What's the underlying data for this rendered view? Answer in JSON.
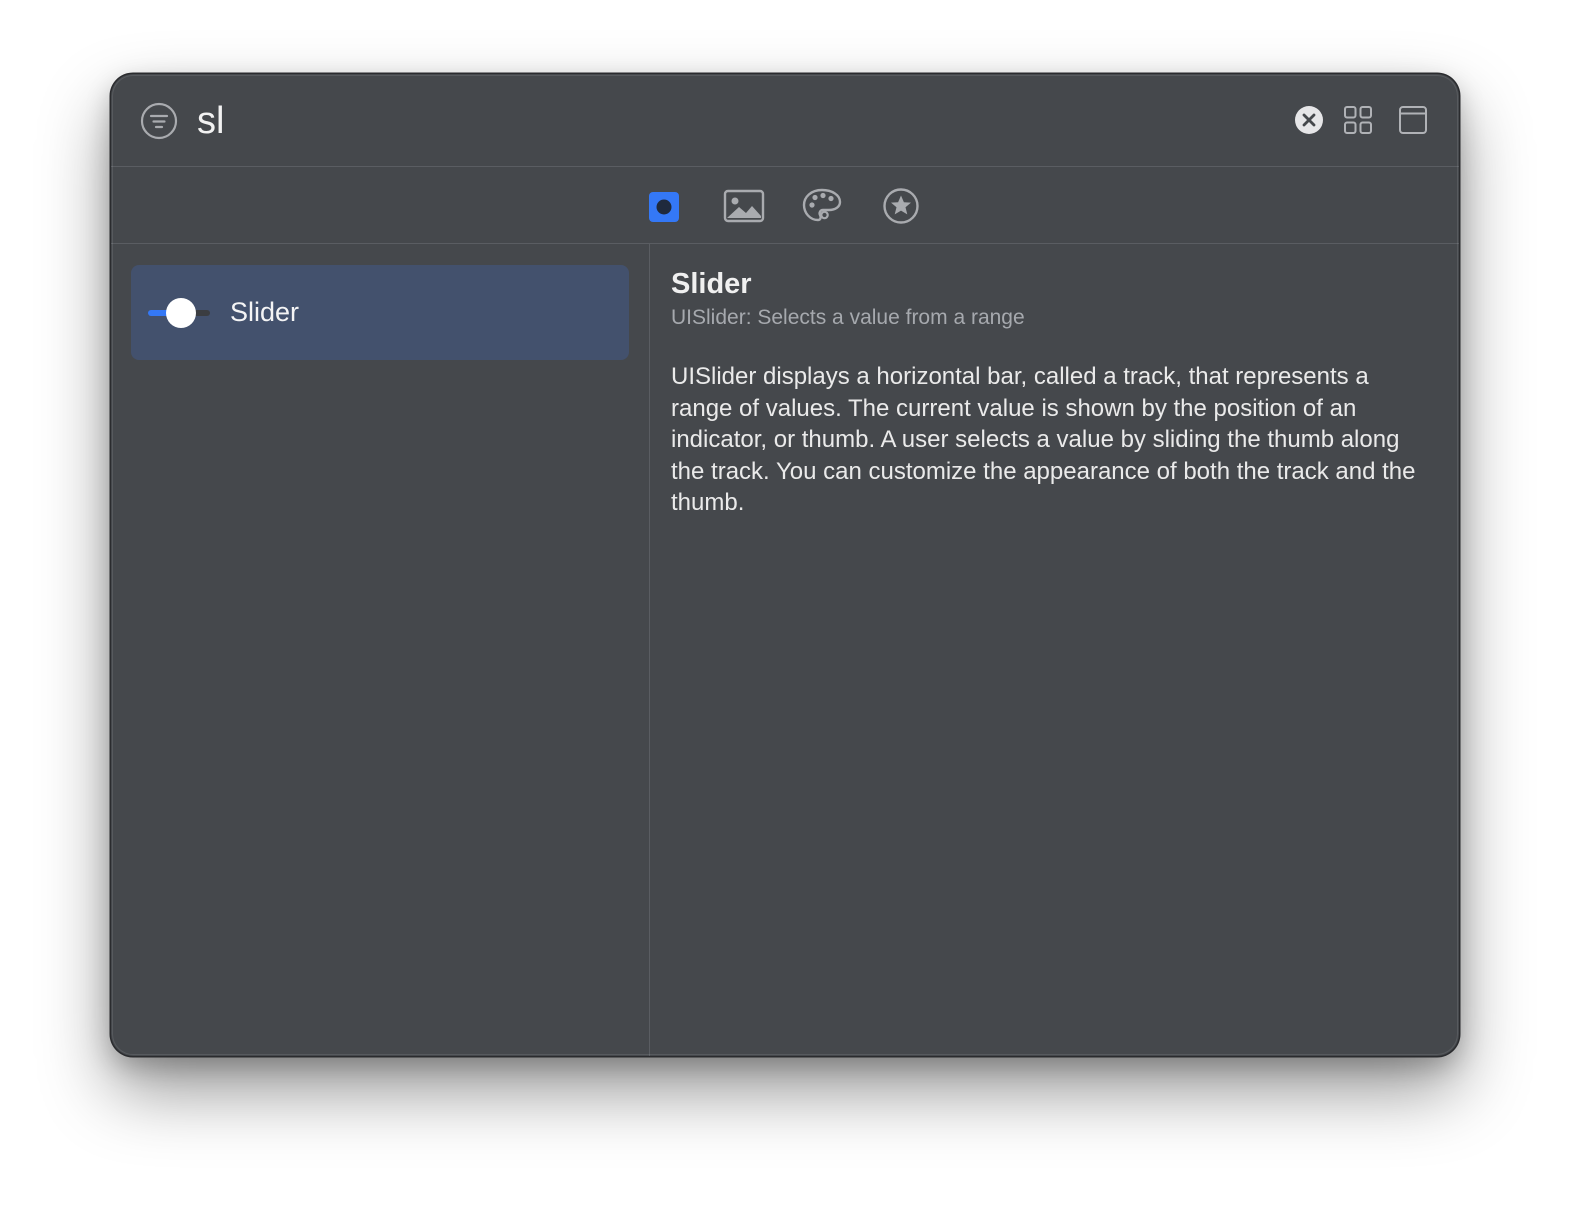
{
  "search": {
    "query": "sl"
  },
  "toolbar": {
    "filter_icon": "filter-icon",
    "clear_icon": "clear-search-icon",
    "grid_icon": "grid-view-icon",
    "window_icon": "window-icon"
  },
  "tabs": [
    {
      "icon": "views-icon",
      "selected": true
    },
    {
      "icon": "media-icon",
      "selected": false
    },
    {
      "icon": "color-palette-icon",
      "selected": false
    },
    {
      "icon": "star-icon",
      "selected": false
    }
  ],
  "results": [
    {
      "label": "Slider",
      "icon": "slider-icon",
      "selected": true
    }
  ],
  "detail": {
    "title": "Slider",
    "subtitle": "UISlider: Selects a value from a range",
    "description": "UISlider displays a horizontal bar, called a track, that represents a range of values. The current value is shown by the position of an indicator, or thumb. A user selects a value by sliding the thumb along the track. You can customize the appearance of both the track and the thumb."
  },
  "colors": {
    "window_background": "#45484c",
    "selected_row": "#43516d",
    "accent": "#3478f6",
    "icon": "#a9abaf"
  }
}
